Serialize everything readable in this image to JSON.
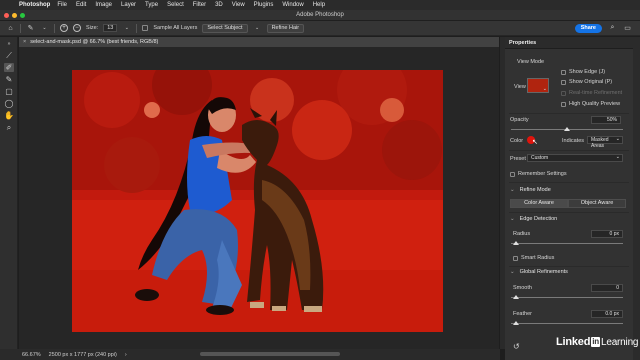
{
  "menubar": {
    "app": "Photoshop",
    "items": [
      "File",
      "Edit",
      "Image",
      "Layer",
      "Type",
      "Select",
      "Filter",
      "3D",
      "View",
      "Plugins",
      "Window",
      "Help"
    ]
  },
  "window": {
    "title": "Adobe Photoshop"
  },
  "options": {
    "size_label": "Size:",
    "size_value": "13",
    "sample_all_layers": "Sample All Layers",
    "select_subject": "Select Subject",
    "refine_hair": "Refine Hair",
    "share": "Share"
  },
  "document": {
    "tab_title": "select-and-mask.psd @ 66.7% (best friends, RGB/8)"
  },
  "status": {
    "zoom": "66.67%",
    "dimensions": "2500 px x 1777 px (240 ppi)"
  },
  "properties": {
    "title": "Properties",
    "view_mode": {
      "header": "View Mode",
      "view_label": "View",
      "show_edge": "Show Edge (J)",
      "show_original": "Show Original (P)",
      "realtime_refinement": "Real-time Refinement",
      "high_quality_preview": "High Quality Preview"
    },
    "opacity": {
      "label": "Opacity",
      "value": "50%",
      "fraction": 0.5
    },
    "color": {
      "label": "Color",
      "swatch": "#e0140c",
      "indicates_label": "Indicates",
      "indicates_value": "Masked Areas"
    },
    "preset": {
      "label": "Preset",
      "value": "Custom"
    },
    "remember_settings": "Remember Settings",
    "refine_mode": {
      "header": "Refine Mode",
      "color_aware": "Color Aware",
      "object_aware": "Object Aware"
    },
    "edge_detection": {
      "header": "Edge Detection",
      "radius_label": "Radius",
      "radius_value": "0 px",
      "smart_radius": "Smart Radius"
    },
    "global_refinements": {
      "header": "Global Refinements",
      "smooth_label": "Smooth",
      "smooth_value": "0",
      "feather_label": "Feather",
      "feather_value": "0.0 px"
    }
  },
  "watermark": {
    "linked": "Linked",
    "in": "in",
    "learning": "Learning"
  },
  "colors": {
    "accent": "#1473e6",
    "overlay_red": "#d8130a"
  }
}
